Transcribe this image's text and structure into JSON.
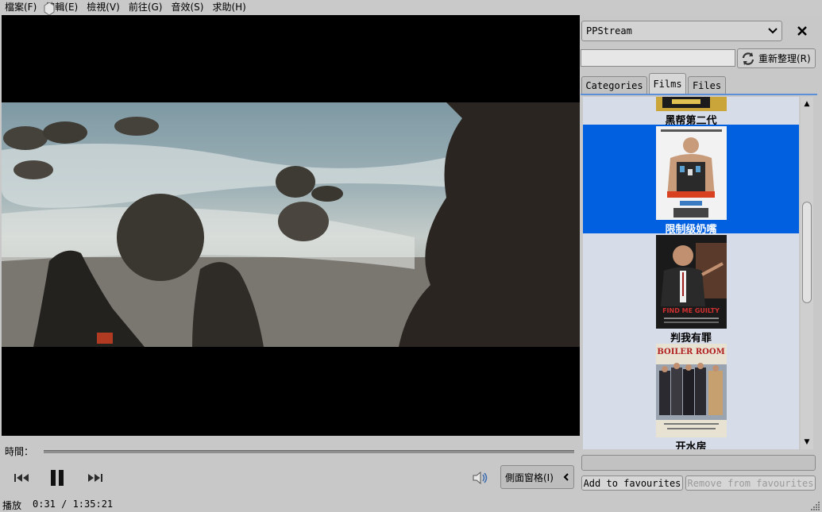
{
  "menubar": {
    "items": [
      "檔案(F)",
      "編輯(E)",
      "檢視(V)",
      "前往(G)",
      "音效(S)",
      "求助(H)"
    ]
  },
  "player": {
    "time_label": "時間：",
    "progress_fraction": 0.006,
    "sidebar_button": "側面窗格(I)",
    "status_state": "播放",
    "status_time": "0:31 / 1:35:21"
  },
  "sidebar": {
    "source": "PPStream",
    "search_value": "",
    "refresh_label": "重新整理(R)",
    "tabs": [
      "Categories",
      "Films",
      "Files"
    ],
    "active_tab": "Films",
    "films": [
      {
        "title": "黑帮第二代"
      },
      {
        "title": "限制级奶嘴",
        "selected": true
      },
      {
        "title": "判我有罪"
      },
      {
        "title": "开水房"
      }
    ],
    "poster_text": {
      "guilty": "FIND ME GUILTY",
      "boiler": "BOILER ROOM"
    },
    "add_fav": "Add to favourites",
    "remove_fav": "Remove from favourites"
  },
  "colors": {
    "selection": "#0060e0",
    "list_bg": "#d6dce8",
    "tab_accent": "#5b8fd6"
  }
}
